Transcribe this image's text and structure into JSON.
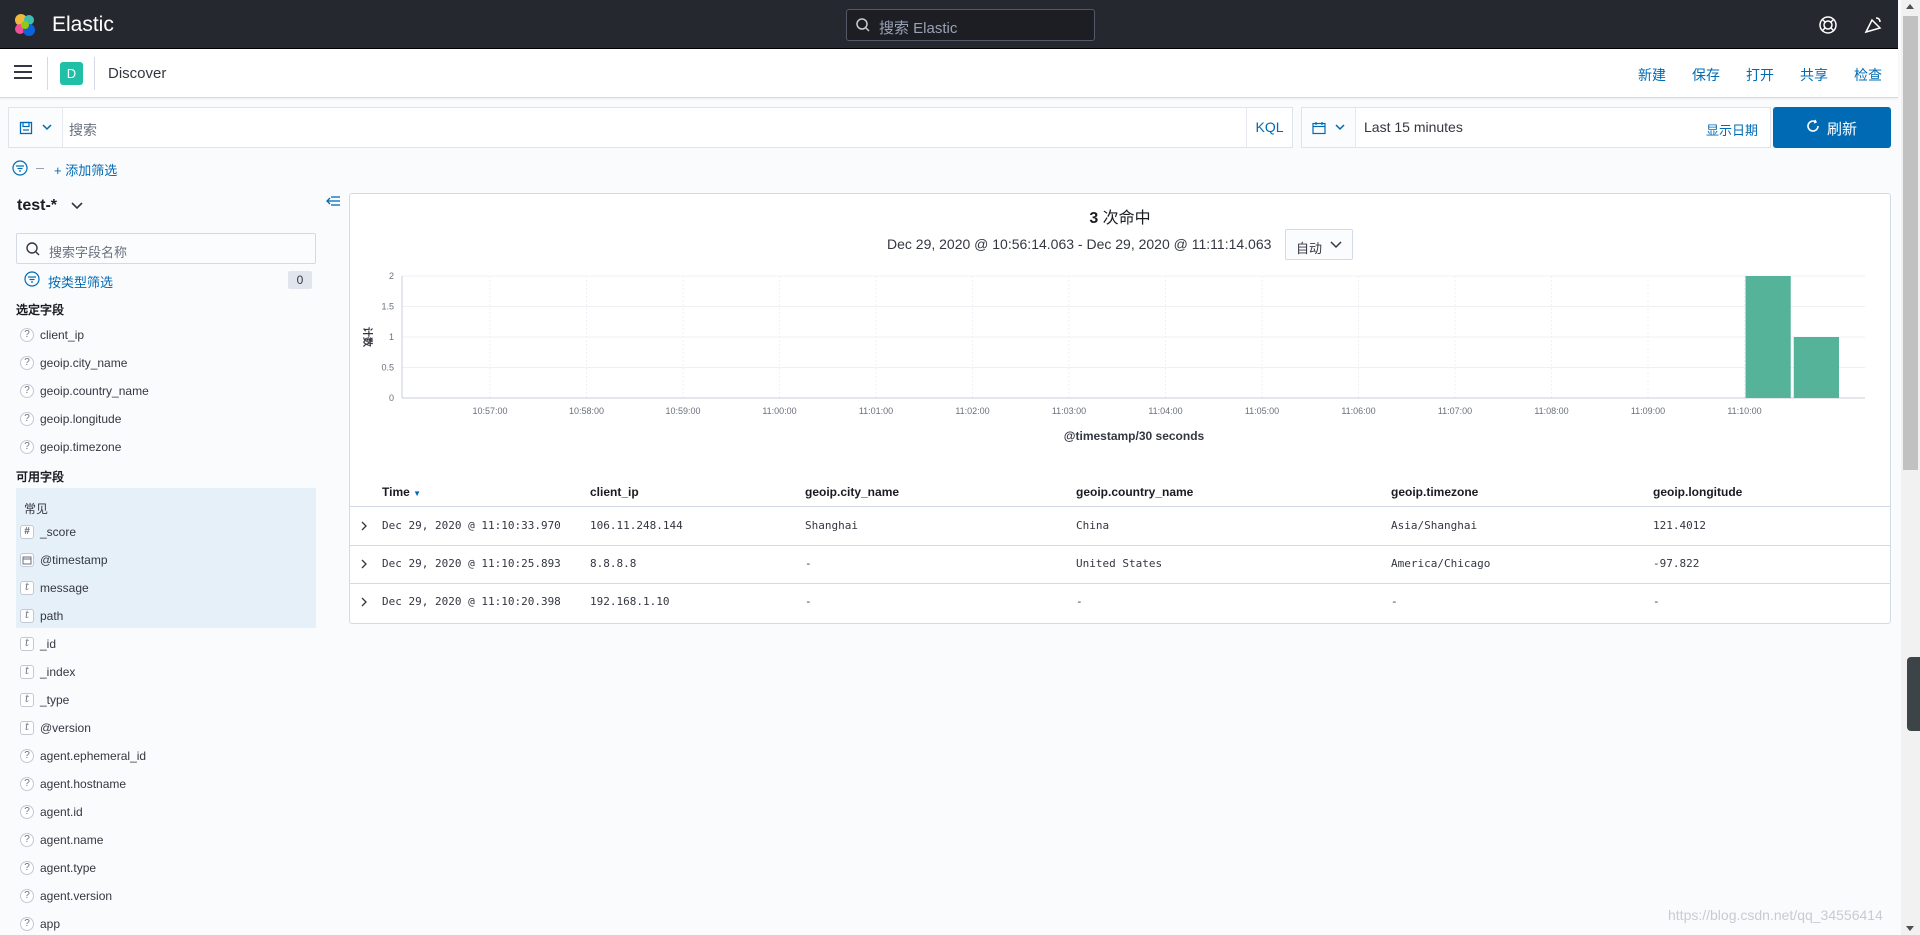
{
  "topbar": {
    "brand": "Elastic",
    "search_placeholder": "搜索 Elastic",
    "help_icon": "help-lifebuoy-icon",
    "newsfeed_icon": "newsfeed-icon"
  },
  "header": {
    "space_initial": "D",
    "app_title": "Discover",
    "menu": [
      "新建",
      "保存",
      "打开",
      "共享",
      "检查"
    ]
  },
  "query_bar": {
    "search_placeholder": "搜索",
    "language": "KQL",
    "time_range": "Last 15 minutes",
    "show_dates": "显示日期",
    "refresh": "刷新"
  },
  "filters": {
    "add_filter": "+ 添加筛选"
  },
  "sidebar": {
    "index_pattern": "test-*",
    "field_search_placeholder": "搜索字段名称",
    "filter_by_type": "按类型筛选",
    "filter_count": "0",
    "selected_title": "选定字段",
    "selected_fields": [
      {
        "type": "?",
        "name": "client_ip"
      },
      {
        "type": "?",
        "name": "geoip.city_name"
      },
      {
        "type": "?",
        "name": "geoip.country_name"
      },
      {
        "type": "?",
        "name": "geoip.longitude"
      },
      {
        "type": "?",
        "name": "geoip.timezone"
      }
    ],
    "available_title": "可用字段",
    "popular_label": "常见",
    "popular_fields": [
      {
        "type": "#",
        "name": "_score"
      },
      {
        "type": "date",
        "name": "@timestamp"
      },
      {
        "type": "t",
        "name": "message"
      },
      {
        "type": "t",
        "name": "path"
      }
    ],
    "other_fields": [
      {
        "type": "t",
        "name": "_id"
      },
      {
        "type": "t",
        "name": "_index"
      },
      {
        "type": "t",
        "name": "_type"
      },
      {
        "type": "t",
        "name": "@version"
      },
      {
        "type": "?",
        "name": "agent.ephemeral_id"
      },
      {
        "type": "?",
        "name": "agent.hostname"
      },
      {
        "type": "?",
        "name": "agent.id"
      },
      {
        "type": "?",
        "name": "agent.name"
      },
      {
        "type": "?",
        "name": "agent.type"
      },
      {
        "type": "?",
        "name": "agent.version"
      },
      {
        "type": "?",
        "name": "app"
      }
    ]
  },
  "results": {
    "hits_count": "3",
    "hits_label": " 次命中",
    "range": "Dec 29, 2020 @ 10:56:14.063 - Dec 29, 2020 @ 11:11:14.063",
    "interval": "自动",
    "columns": [
      "Time",
      "client_ip",
      "geoip.city_name",
      "geoip.country_name",
      "geoip.timezone",
      "geoip.longitude"
    ],
    "rows": [
      [
        "Dec 29, 2020 @ 11:10:33.970",
        "106.11.248.144",
        "Shanghai",
        "China",
        "Asia/Shanghai",
        "121.4012"
      ],
      [
        "Dec 29, 2020 @ 11:10:25.893",
        "8.8.8.8",
        " -",
        "United States",
        "America/Chicago",
        "-97.822"
      ],
      [
        "Dec 29, 2020 @ 11:10:20.398",
        "192.168.1.10",
        " -",
        " -",
        " -",
        " -"
      ]
    ]
  },
  "chart_data": {
    "type": "bar",
    "xlabel": "@timestamp/30 seconds",
    "ylabel": "计数",
    "x_ticks": [
      "10:57:00",
      "10:58:00",
      "10:59:00",
      "11:00:00",
      "11:01:00",
      "11:02:00",
      "11:03:00",
      "11:04:00",
      "11:05:00",
      "11:06:00",
      "11:07:00",
      "11:08:00",
      "11:09:00",
      "11:10:00"
    ],
    "y_ticks": [
      "0",
      "0.5",
      "1",
      "1.5",
      "2"
    ],
    "ylim": [
      0,
      2
    ],
    "bars": [
      {
        "bucket": "11:10:00",
        "value": 2
      },
      {
        "bucket": "11:10:30",
        "value": 1
      }
    ],
    "color": "#54b399",
    "grid": true
  },
  "watermark": "https://blog.csdn.net/qq_34556414"
}
